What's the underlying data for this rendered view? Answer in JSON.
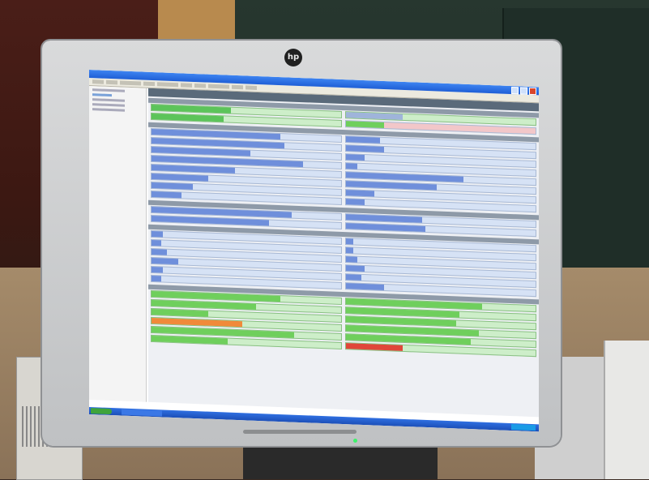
{
  "monitor": {
    "brand_logo": "hp"
  },
  "colors": {
    "bar_blue": "#6f8fdb",
    "bar_green": "#6fcf5c",
    "bar_red": "#e0463a",
    "bar_orange": "#f08a3a",
    "row_pink": "#f2c7c9"
  },
  "screen_rows": {
    "top_group": [
      {
        "left_fill": 0.42,
        "left_color": "#5cc45a",
        "right_fill": 0.3,
        "right_color": "#9fb4da"
      },
      {
        "left_fill": 0.38,
        "left_color": "#5cc45a",
        "right_fill": 0.2,
        "right_color": "#f2c7c9"
      }
    ],
    "blue_group_1": [
      {
        "left_fill": 0.68,
        "right_fill": 0.18
      },
      {
        "left_fill": 0.7,
        "right_fill": 0.2
      },
      {
        "left_fill": 0.52,
        "right_fill": 0.1
      },
      {
        "left_fill": 0.8,
        "right_fill": 0.06
      },
      {
        "left_fill": 0.44,
        "right_fill": 0.62
      },
      {
        "left_fill": 0.3,
        "right_fill": 0.48
      },
      {
        "left_fill": 0.22,
        "right_fill": 0.15
      },
      {
        "left_fill": 0.16,
        "right_fill": 0.1
      }
    ],
    "blue_group_2": [
      {
        "left_fill": 0.74,
        "right_fill": 0.4
      },
      {
        "left_fill": 0.62,
        "right_fill": 0.42
      }
    ],
    "blue_group_3": [
      {
        "left_fill": 0.06,
        "right_fill": 0.04
      },
      {
        "left_fill": 0.05,
        "right_fill": 0.04
      },
      {
        "left_fill": 0.08,
        "right_fill": 0.06
      },
      {
        "left_fill": 0.14,
        "right_fill": 0.1
      },
      {
        "left_fill": 0.06,
        "right_fill": 0.08
      },
      {
        "left_fill": 0.05,
        "right_fill": 0.2
      }
    ],
    "green_group": [
      {
        "left_fill": 0.68,
        "left_color": "#6fcf5c",
        "right_fill": 0.72,
        "right_color": "#6fcf5c"
      },
      {
        "left_fill": 0.55,
        "left_color": "#6fcf5c",
        "right_fill": 0.6,
        "right_color": "#6fcf5c"
      },
      {
        "left_fill": 0.3,
        "left_color": "#6fcf5c",
        "right_fill": 0.58,
        "right_color": "#6fcf5c"
      },
      {
        "left_fill": 0.48,
        "left_color": "#f08a3a",
        "right_fill": 0.7,
        "right_color": "#6fcf5c"
      },
      {
        "left_fill": 0.75,
        "left_color": "#6fcf5c",
        "right_fill": 0.66,
        "right_color": "#6fcf5c"
      },
      {
        "left_fill": 0.4,
        "left_color": "#6fcf5c",
        "right_fill": 0.3,
        "right_color": "#e0463a"
      }
    ]
  }
}
